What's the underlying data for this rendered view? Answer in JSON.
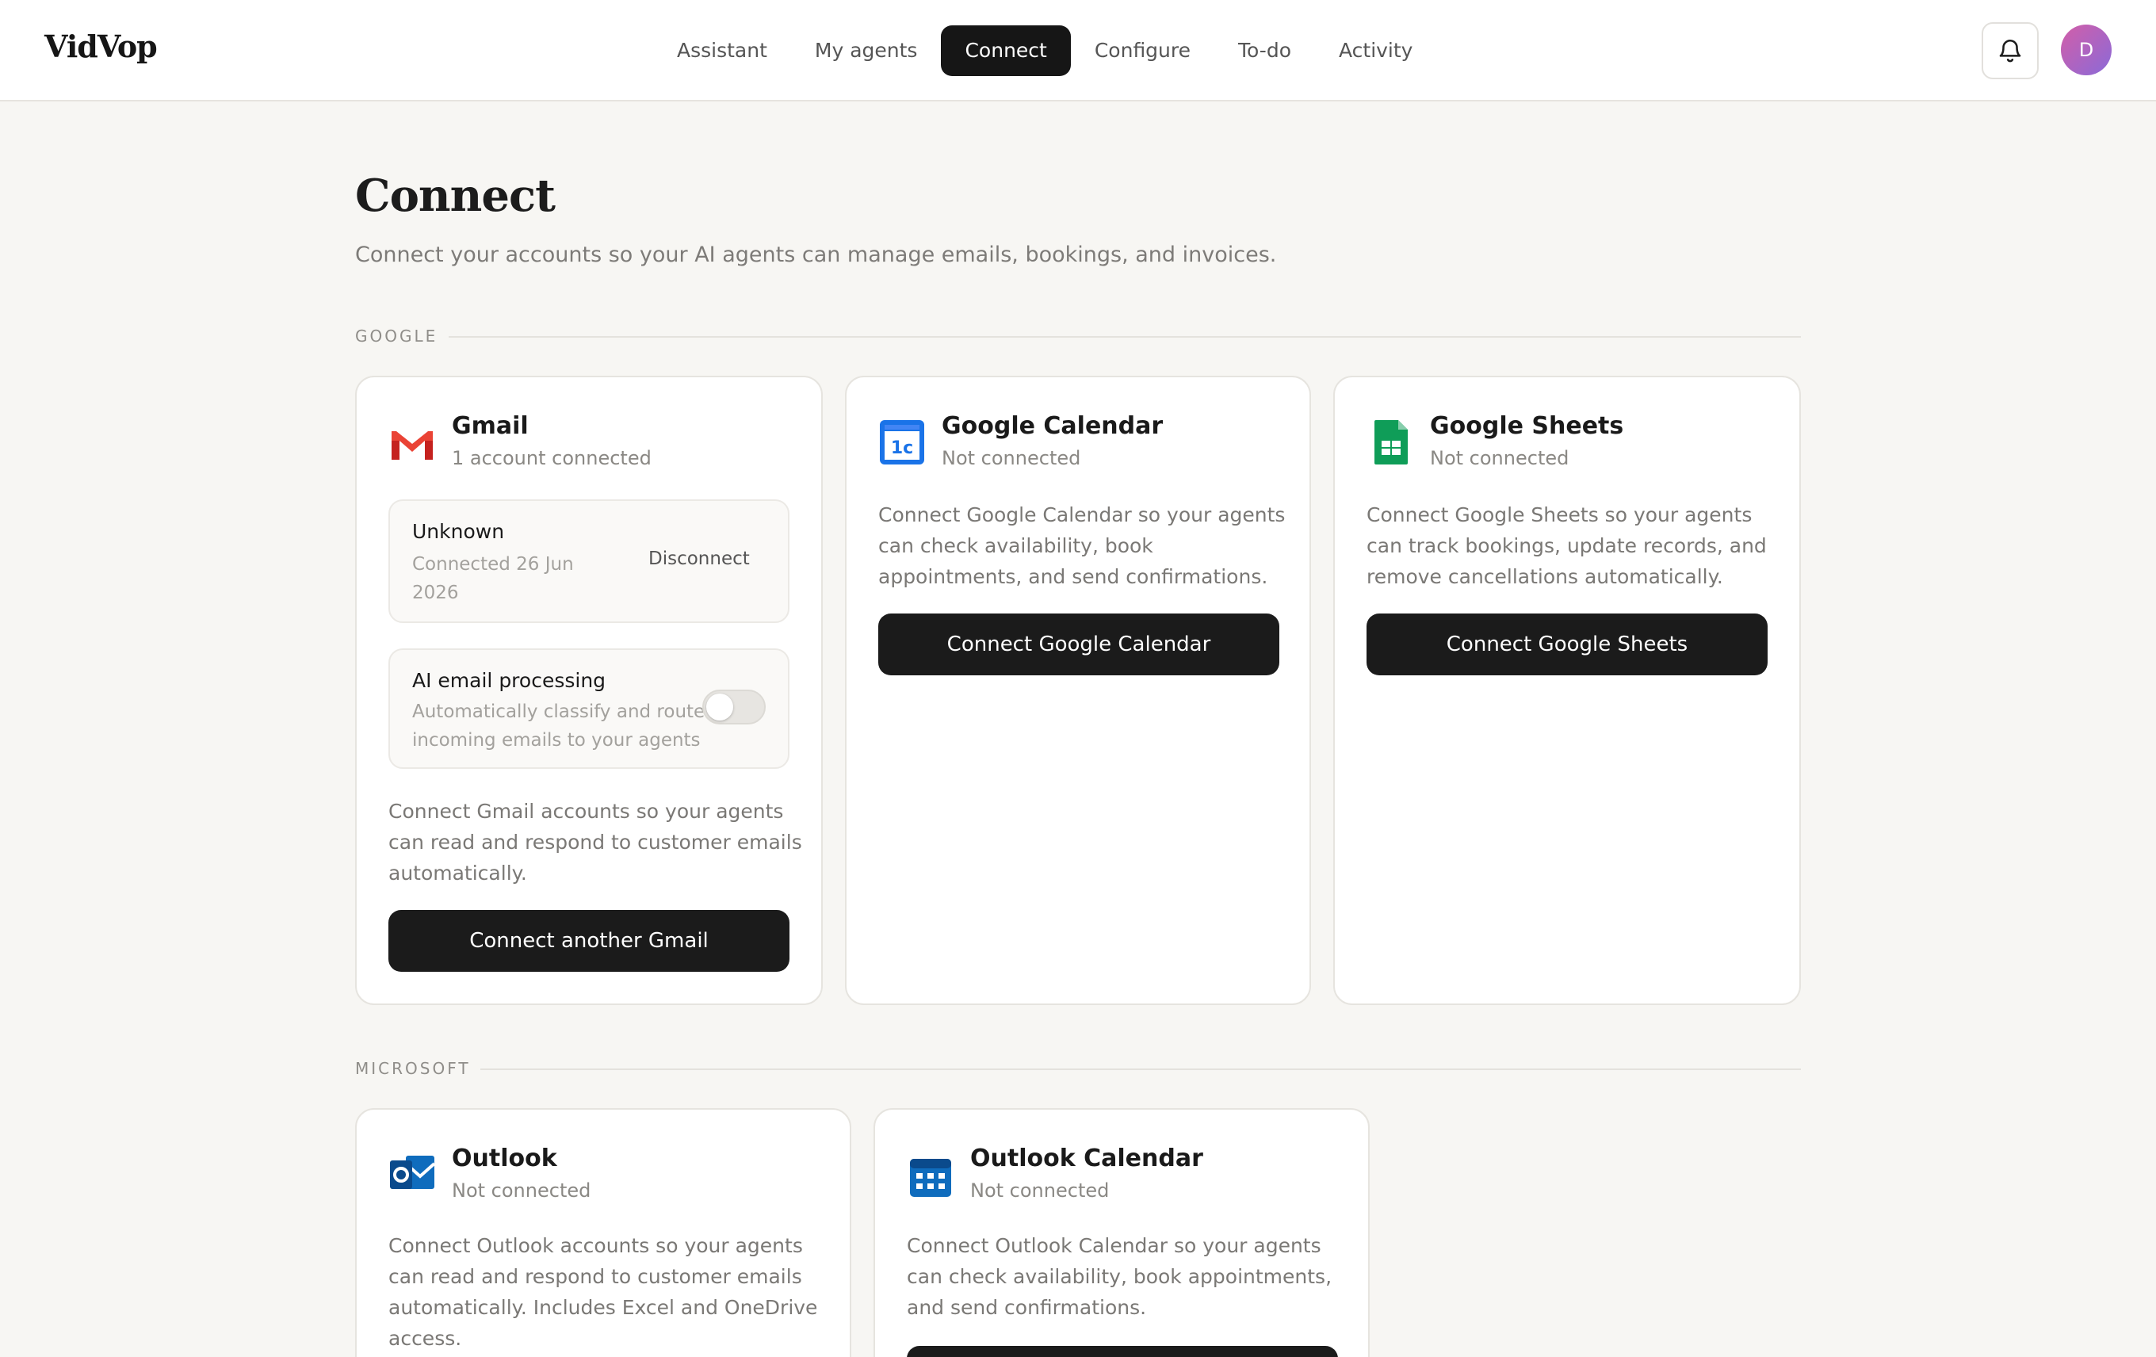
{
  "app": {
    "logo": "VidVop"
  },
  "nav": {
    "items": [
      {
        "label": "Assistant"
      },
      {
        "label": "My agents"
      },
      {
        "label": "Connect",
        "active": true
      },
      {
        "label": "Configure"
      },
      {
        "label": "To-do"
      },
      {
        "label": "Activity"
      }
    ]
  },
  "header": {
    "bell_icon": "bell-icon",
    "avatar_initial": "D",
    "avatar_colors": [
      "#d35ea8",
      "#8a6ad8"
    ]
  },
  "page": {
    "title": "Connect",
    "subtitle": "Connect your accounts so your AI agents can manage emails, bookings, and invoices."
  },
  "sections": {
    "google": {
      "label": "GOOGLE",
      "gmail": {
        "title": "Gmail",
        "status": "1 account connected",
        "account": {
          "name": "Unknown",
          "connected_line1": "Connected 26 Jun",
          "connected_line2": "2026",
          "disconnect_label": "Disconnect"
        },
        "ai_processing": {
          "title": "AI email processing",
          "desc_line1": "Automatically classify and route",
          "desc_line2": "incoming emails to your agents",
          "enabled": false
        },
        "desc_line1": "Connect Gmail accounts so your agents",
        "desc_line2": "can read and respond to customer emails",
        "desc_line3": "automatically.",
        "button": "Connect another Gmail",
        "icon_color": "#ea4335"
      },
      "calendar": {
        "title": "Google Calendar",
        "status": "Not connected",
        "desc_line1": "Connect Google Calendar so your agents",
        "desc_line2": "can check availability, book",
        "desc_line3": "appointments, and send confirmations.",
        "button": "Connect Google Calendar",
        "icon_color": "#1a73e8"
      },
      "sheets": {
        "title": "Google Sheets",
        "status": "Not connected",
        "desc_line1": "Connect Google Sheets so your agents",
        "desc_line2": "can track bookings, update records, and",
        "desc_line3": "remove cancellations automatically.",
        "button": "Connect Google Sheets",
        "icon_color": "#0f9d58"
      }
    },
    "microsoft": {
      "label": "MICROSOFT",
      "outlook": {
        "title": "Outlook",
        "status": "Not connected",
        "desc_line1": "Connect Outlook accounts so your agents",
        "desc_line2": "can read and respond to customer emails",
        "desc_line3": "automatically. Includes Excel and OneDrive",
        "desc_line4": "access.",
        "icon_color": "#0f6cbd"
      },
      "outlook_calendar": {
        "title": "Outlook Calendar",
        "status": "Not connected",
        "desc_line1": "Connect Outlook Calendar so your agents",
        "desc_line2": "can check availability, book appointments,",
        "desc_line3": "and send confirmations.",
        "icon_color": "#0f6cbd"
      }
    }
  }
}
